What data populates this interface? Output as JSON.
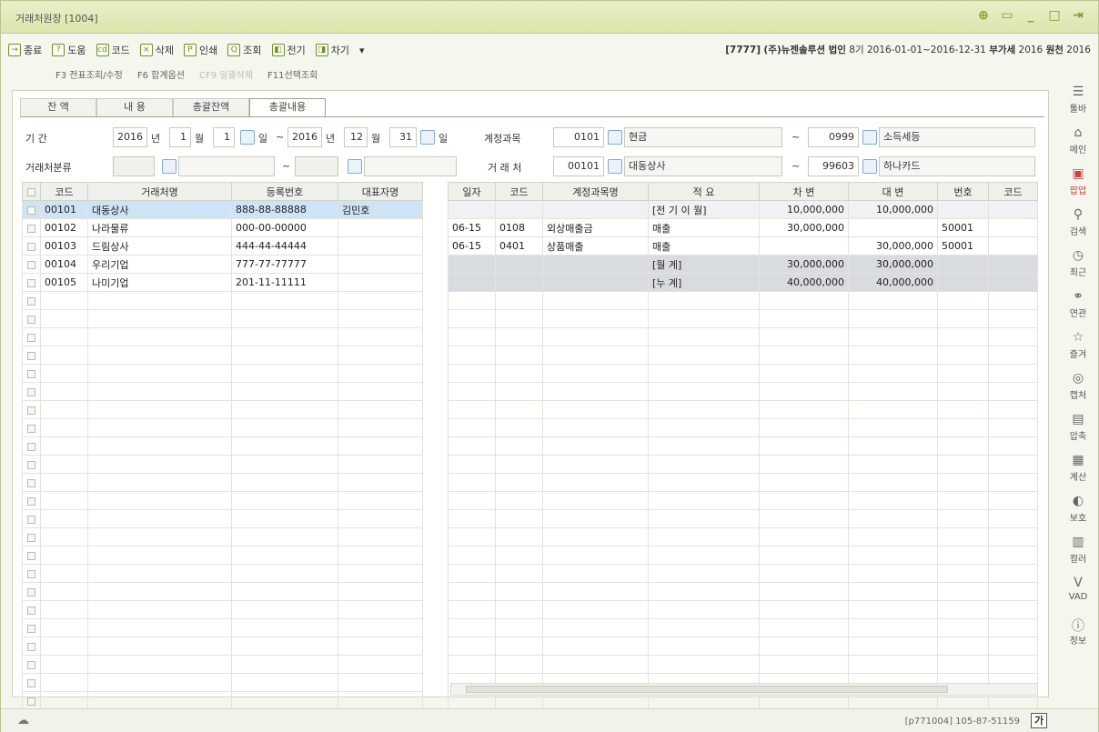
{
  "window": {
    "title": "거래처원장 [1004]",
    "controls": [
      "zoom-icon",
      "restore-icon",
      "minimize-icon",
      "maximize-icon",
      "exit-icon"
    ]
  },
  "toolbar": [
    {
      "label": "종료",
      "icon": "exit-icon"
    },
    {
      "label": "도움",
      "icon": "help-icon"
    },
    {
      "label": "코드",
      "icon": "code-icon"
    },
    {
      "label": "삭제",
      "icon": "delete-icon"
    },
    {
      "label": "인쇄",
      "icon": "print-icon"
    },
    {
      "label": "조회",
      "icon": "search-icon"
    },
    {
      "label": "전기",
      "icon": "transfer-icon"
    },
    {
      "label": "차기",
      "icon": "next-icon"
    },
    {
      "label": "▾",
      "icon": "more-icon"
    }
  ],
  "company": {
    "code": "[7777]",
    "name": "(주)뉴젠솔루션 법인",
    "period": "8기 2016-01-01~2016-12-31",
    "vat_label": "부가세",
    "vat_year": "2016",
    "income_label": "원천",
    "income_year": "2016"
  },
  "fkeys": [
    {
      "label": "F3 전표조회/수정",
      "enabled": true
    },
    {
      "label": "F6 합계옵션",
      "enabled": true
    },
    {
      "label": "CF9 일괄삭제",
      "enabled": false
    },
    {
      "label": "F11선택조회",
      "enabled": true
    }
  ],
  "tabs": [
    "잔 액",
    "내 용",
    "총괄잔액",
    "총괄내용"
  ],
  "filter": {
    "period_label": "기          간",
    "from_year": "2016",
    "year_unit": "년",
    "from_month": "1",
    "month_unit": "월",
    "from_day": "1",
    "day_unit": "일",
    "sep": "~",
    "to_year": "2016",
    "to_month": "12",
    "to_day": "31",
    "account_label": "계정과목",
    "account_from_code": "0101",
    "account_from_name": "현금",
    "account_to_code": "0999",
    "account_to_name": "소득세등",
    "class_label": "거래처분류",
    "vendor_label": "거 래 처",
    "vendor_from_code": "00101",
    "vendor_from_name": "대동상사",
    "vendor_to_code": "99603",
    "vendor_to_name": "하나카드"
  },
  "left_grid": {
    "headers": [
      "코드",
      "거래처명",
      "등록번호",
      "대표자명"
    ],
    "rows": [
      {
        "code": "00101",
        "name": "대동상사",
        "reg": "888-88-88888",
        "ceo": "김민호"
      },
      {
        "code": "00102",
        "name": "나라물류",
        "reg": "000-00-00000",
        "ceo": ""
      },
      {
        "code": "00103",
        "name": "드림상사",
        "reg": "444-44-44444",
        "ceo": ""
      },
      {
        "code": "00104",
        "name": "우리기업",
        "reg": "777-77-77777",
        "ceo": ""
      },
      {
        "code": "00105",
        "name": "나미기업",
        "reg": "201-11-11111",
        "ceo": ""
      }
    ]
  },
  "right_grid": {
    "headers": [
      "일자",
      "코드",
      "계정과목명",
      "적 요",
      "차   변",
      "대   변",
      "번호",
      "코드"
    ],
    "rows": [
      {
        "date": "",
        "code": "",
        "account": "",
        "memo": "[전 기 이 월]",
        "debit": "10,000,000",
        "credit": "10,000,000",
        "no": "",
        "code2": "",
        "kind": "carry"
      },
      {
        "date": "06-15",
        "code": "0108",
        "account": "외상매출금",
        "memo": "매출",
        "debit": "30,000,000",
        "credit": "",
        "no": "50001",
        "code2": "",
        "kind": ""
      },
      {
        "date": "06-15",
        "code": "0401",
        "account": "상품매출",
        "memo": "매출",
        "debit": "",
        "credit": "30,000,000",
        "no": "50001",
        "code2": "",
        "kind": ""
      },
      {
        "date": "",
        "code": "",
        "account": "",
        "memo": "[월          계]",
        "debit": "30,000,000",
        "credit": "30,000,000",
        "no": "",
        "code2": "",
        "kind": "sum"
      },
      {
        "date": "",
        "code": "",
        "account": "",
        "memo": "[누          계]",
        "debit": "40,000,000",
        "credit": "40,000,000",
        "no": "",
        "code2": "",
        "kind": "sum"
      }
    ]
  },
  "rightbar": [
    {
      "label": "툴바",
      "icon": "menu-icon"
    },
    {
      "label": "메인",
      "icon": "home-icon"
    },
    {
      "label": "팝업",
      "icon": "popup-icon",
      "red": true
    },
    {
      "label": "검색",
      "icon": "search-icon"
    },
    {
      "label": "최근",
      "icon": "clock-icon"
    },
    {
      "label": "연관",
      "icon": "link-icon"
    },
    {
      "label": "즐겨",
      "icon": "star-icon"
    },
    {
      "label": "캡처",
      "icon": "camera-icon"
    },
    {
      "label": "압축",
      "icon": "compress-icon"
    },
    {
      "label": "계산",
      "icon": "calculator-icon"
    },
    {
      "label": "보호",
      "icon": "shield-icon"
    },
    {
      "label": "컬러",
      "icon": "palette-icon"
    },
    {
      "label": "VAD",
      "icon": "vad-icon"
    },
    {
      "label": "정보",
      "icon": "info-icon"
    }
  ],
  "status": {
    "right": "[p771004]  105-87-51159",
    "btn": "가"
  }
}
